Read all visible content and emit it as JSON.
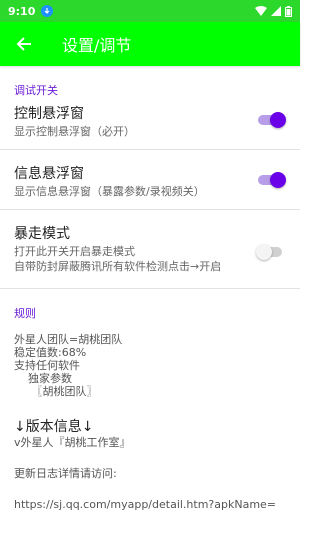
{
  "status_bar": {
    "time": "9:10",
    "notif_icon": "download-icon"
  },
  "app_bar": {
    "title": "设置/调节",
    "background_color": "#00ff00"
  },
  "sections": {
    "debug": {
      "header": "调试开关",
      "items": [
        {
          "title": "控制悬浮窗",
          "summary": "显示控制悬浮窗（必开）",
          "enabled": true
        },
        {
          "title": "信息悬浮窗",
          "summary": "显示信息悬浮窗（暴露参数/录视频关）",
          "enabled": true
        },
        {
          "title": "暴走模式",
          "summary": "打开此开关开启暴走模式\n自带防封屏蔽腾讯所有软件检测点击→开启",
          "enabled": false
        }
      ]
    },
    "rules": {
      "header": "规则",
      "text": "外星人团队=胡桃团队\n稳定值数:68%\n支持任何软件\n    独家参数\n     〖胡桃团队〗"
    },
    "version": {
      "title": "↓版本信息↓",
      "subtitle": "v外星人『胡桃工作室』"
    },
    "update": {
      "label": "更新日志详情请访问:",
      "url": "https://sj.qq.com/myapp/detail.htm?apkName="
    }
  },
  "colors": {
    "accent": "#6a00e8",
    "category_text": "#6a1bd6",
    "status_bar": "#2bd82b"
  }
}
